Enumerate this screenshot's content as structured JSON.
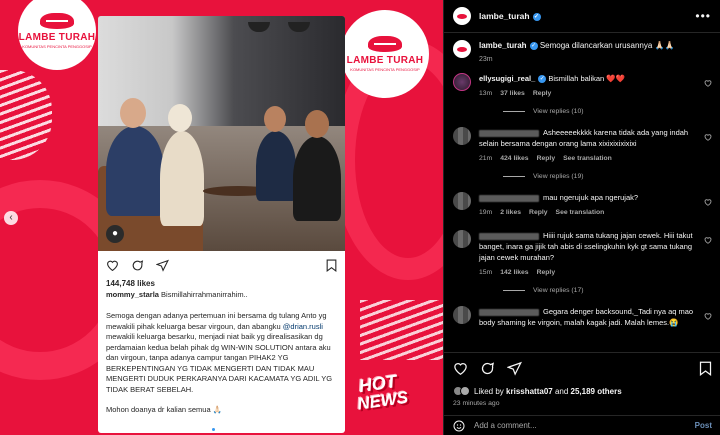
{
  "media": {
    "logo_brand": "LAMBE TURAH",
    "logo_tagline": "KOMUNITAS PENCINTA PENGGOSIP",
    "card": {
      "likes": "144,748 likes",
      "username": "mommy_starla",
      "user_caption": "Bismillahirrahmanirrahim..",
      "body_p1_a": "Semoga dengan adanya pertemuan ini bersama dg tulang Anto yg mewakili pihak keluarga besar virgoun, dan abangku ",
      "body_p1_mention": "@drian.rusli",
      "body_p1_b": " mewakili keluarga besarku, menjadi niat baik yg direalisasikan dg perdamaian kedua belah pihak dg WIN-WIN SOLUTION antara aku dan virgoun, tanpa adanya campur tangan PIHAK2 YG BERKEPENTINGAN YG TIDAK MENGERTI DAN TIDAK MAU MENGERTI DUDUK PERKARANYA DARI KACAMATA YG ADIL YG TIDAK BERAT SEBELAH.",
      "body_p2": "Mohon doanya dr kalian semua 🙏🏻"
    },
    "sticker_line1": "HOT",
    "sticker_line2": "NEWS"
  },
  "header": {
    "username": "lambe_turah",
    "more": "•••"
  },
  "caption": {
    "username": "lambe_turah",
    "text": "Semoga dilancarkan urusannya 🙏🏻🙏🏻",
    "time": "23m"
  },
  "comments": [
    {
      "username": "ellysugigi_real_",
      "text": "Bismillah balikan ❤️❤️",
      "time": "13m",
      "likes": "37 likes",
      "reply": "Reply",
      "translate": "",
      "view_replies": "View replies (10)"
    },
    {
      "username": "",
      "text": "Asheeeeekkkk karena tidak ada yang indah selain bersama dengan orang lama xixixixixixixi",
      "time": "21m",
      "likes": "424 likes",
      "reply": "Reply",
      "translate": "See translation",
      "view_replies": "View replies (19)"
    },
    {
      "username": "",
      "text": "mau ngerujuk apa ngerujak?",
      "time": "19m",
      "likes": "2 likes",
      "reply": "Reply",
      "translate": "See translation",
      "view_replies": ""
    },
    {
      "username": "",
      "text": "Hiiii rujuk sama tukang jajan cewek. Hiii takut banget, inara ga jijik tah abis di sselingkuhin kyk gt sama tukang jajan cewek murahan?",
      "time": "15m",
      "likes": "142 likes",
      "reply": "Reply",
      "translate": "",
      "view_replies": "View replies (17)"
    },
    {
      "username": "",
      "text": "Gegara denger backsound,_Tadi nya aq mao body shaming ke virgoin, malah kagak jadi. Malah lemes.😭",
      "time": "",
      "likes": "",
      "reply": "",
      "translate": "",
      "view_replies": ""
    }
  ],
  "actions": {
    "liked_prefix": "Liked by ",
    "liked_user": "krisshatta07",
    "liked_and": " and ",
    "liked_count": "25,189 others",
    "ago": "23 minutes ago"
  },
  "composer": {
    "placeholder": "Add a comment...",
    "post_label": "Post"
  },
  "colors": {
    "media_red": "#e8123c",
    "accent_blue": "#3897f0",
    "heart_red": "#ed4956"
  }
}
